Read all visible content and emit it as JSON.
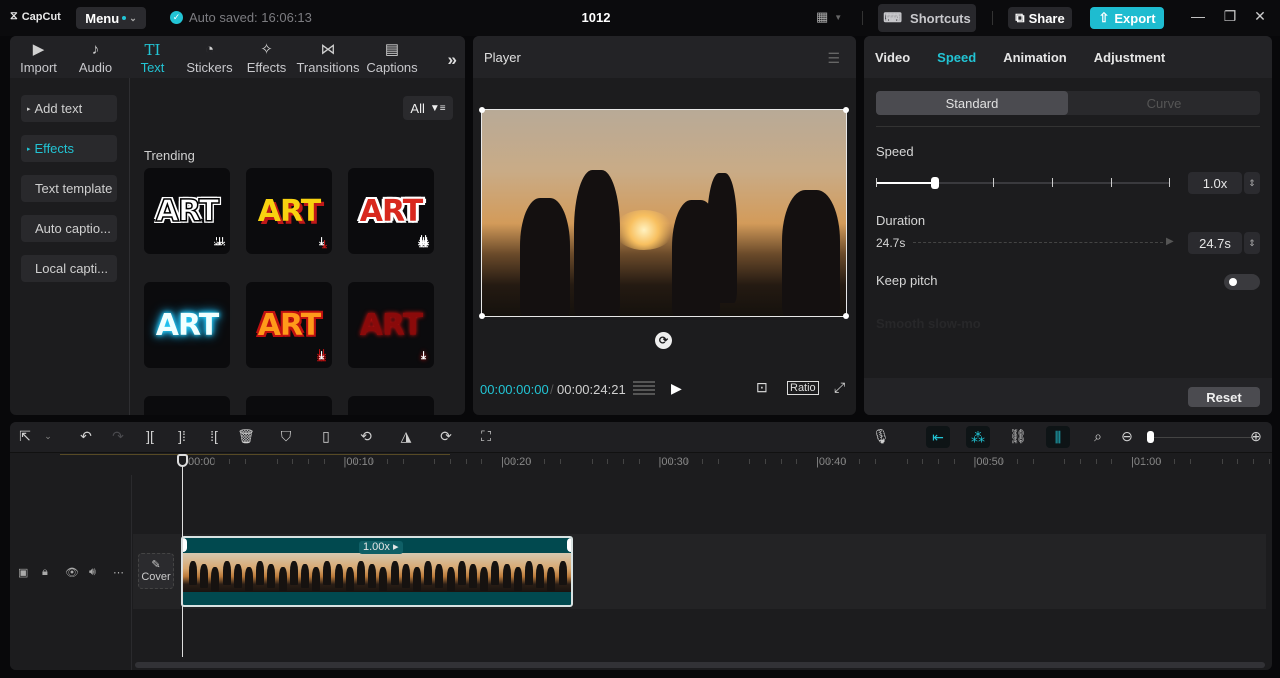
{
  "titlebar": {
    "app_name": "CapCut",
    "menu_label": "Menu",
    "autosave_text": "Auto saved: 16:06:13",
    "project_title": "1012",
    "shortcuts_label": "Shortcuts",
    "share_label": "Share",
    "export_label": "Export",
    "window_controls": {
      "minimize": "—",
      "maximize": "❐",
      "close": "✕"
    }
  },
  "left_panel": {
    "tabs": [
      {
        "label": "Import",
        "icon": "import-icon",
        "glyph": "▶"
      },
      {
        "label": "Audio",
        "icon": "audio-icon",
        "glyph": "♪"
      },
      {
        "label": "Text",
        "icon": "text-icon",
        "glyph": "TI"
      },
      {
        "label": "Stickers",
        "icon": "stickers-icon",
        "glyph": "◔"
      },
      {
        "label": "Effects",
        "icon": "effects-icon",
        "glyph": "✧"
      },
      {
        "label": "Transitions",
        "icon": "transitions-icon",
        "glyph": "⋈"
      },
      {
        "label": "Captions",
        "icon": "captions-icon",
        "glyph": "▤"
      }
    ],
    "active_tab": "Text",
    "more_glyph": "»",
    "nav": [
      {
        "label": "Add text",
        "arrow": "▸"
      },
      {
        "label": "Effects",
        "arrow": "▸"
      },
      {
        "label": "Text template",
        "arrow": ""
      },
      {
        "label": "Auto captio...",
        "arrow": ""
      },
      {
        "label": "Local capti...",
        "arrow": ""
      }
    ],
    "filter_label": "All",
    "filter_glyph": "⏷",
    "section_title": "Trending",
    "cards": [
      {
        "text": "ART",
        "style": "white-outline",
        "download": true
      },
      {
        "text": "ART",
        "style": "yellow-red-shadow",
        "download": true
      },
      {
        "text": "ART",
        "style": "red-white-outline",
        "download": true
      },
      {
        "text": "ART",
        "style": "cyan-glow",
        "download": false
      },
      {
        "text": "ART",
        "style": "orange-gradient",
        "download": true
      },
      {
        "text": "ART",
        "style": "dark-red-grunge",
        "download": true
      }
    ],
    "download_glyph": "⤓"
  },
  "player": {
    "title": "Player",
    "current_time": "00:00:00:00",
    "separator": "/",
    "total_time": "00:00:24:21",
    "ratio_label": "Ratio"
  },
  "properties": {
    "tabs": [
      "Video",
      "Speed",
      "Animation",
      "Adjustment"
    ],
    "active_tab": "Speed",
    "mode_options": [
      "Standard",
      "Curve"
    ],
    "active_mode": "Standard",
    "speed_label": "Speed",
    "speed_value": "1.0x",
    "speed_slider_fraction": 0.2,
    "duration_label": "Duration",
    "duration_start": "24.7s",
    "duration_value": "24.7s",
    "keep_pitch_label": "Keep pitch",
    "keep_pitch_on": false,
    "smooth_slowmo_label": "Smooth slow-mo",
    "reset_label": "Reset"
  },
  "timeline": {
    "ruler_labels": [
      "00:00",
      "00:10",
      "00:20",
      "00:30",
      "00:40",
      "00:50",
      "01:00"
    ],
    "clip_speed_label": "1.00x ▸",
    "cover_label": "Cover",
    "cover_glyph": "✎",
    "track_controls": [
      "video-track",
      "lock",
      "visibility",
      "audio",
      "more"
    ]
  }
}
